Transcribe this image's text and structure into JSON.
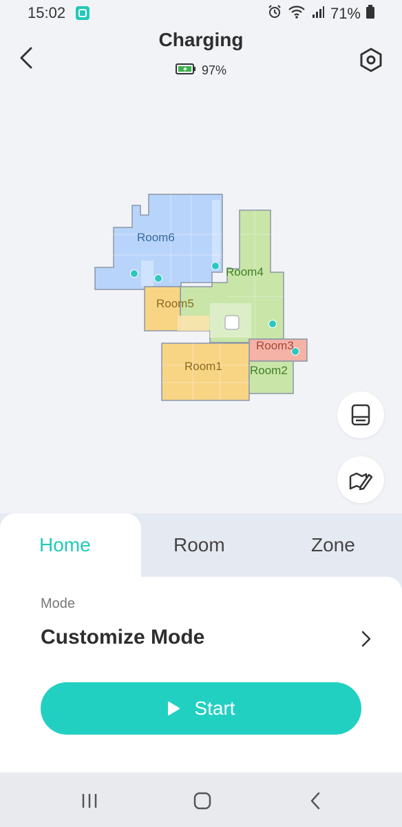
{
  "status_bar": {
    "time": "15:02",
    "battery_percent": "71%",
    "icons": [
      "app-notification-icon",
      "alarm-icon",
      "wifi-icon",
      "signal-icon",
      "battery-icon"
    ]
  },
  "header": {
    "title": "Charging",
    "battery": "97%"
  },
  "map": {
    "rooms": [
      {
        "name": "Room6",
        "color": "#b9d4fb"
      },
      {
        "name": "Room4",
        "color": "#c9e6a8"
      },
      {
        "name": "Room5",
        "color": "#f8d585"
      },
      {
        "name": "Room3",
        "color": "#f5b2a6"
      },
      {
        "name": "Room1",
        "color": "#f8d585"
      },
      {
        "name": "Room2",
        "color": "#c9e6a8"
      }
    ]
  },
  "side_buttons": [
    "vacuum-base-icon",
    "map-edit-icon"
  ],
  "tabs": [
    {
      "label": "Home",
      "active": true
    },
    {
      "label": "Room",
      "active": false
    },
    {
      "label": "Zone",
      "active": false
    }
  ],
  "mode": {
    "label": "Mode",
    "value": "Customize Mode"
  },
  "start_button": {
    "label": "Start"
  },
  "colors": {
    "accent": "#22c9b8",
    "start_button": "#22d0c2",
    "background": "#f2f3f7"
  },
  "nav_bar": [
    "recents-icon",
    "home-icon",
    "back-icon"
  ]
}
